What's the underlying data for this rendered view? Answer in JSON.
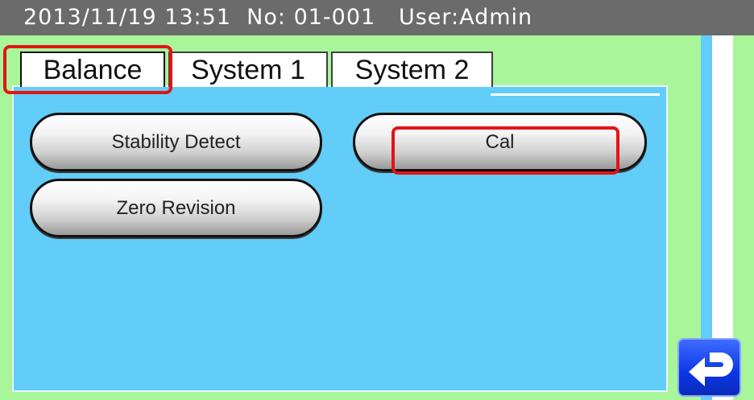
{
  "status": {
    "text": "2013/11/19 13:51  No: 01-001   User:Admin"
  },
  "tabs": [
    {
      "label": "Balance",
      "active": true
    },
    {
      "label": "System 1",
      "active": false
    },
    {
      "label": "System 2",
      "active": false
    }
  ],
  "buttons": {
    "stability_detect": "Stability Detect",
    "cal": "Cal",
    "zero_revision": "Zero Revision"
  },
  "icons": {
    "back": "return-arrow-icon"
  },
  "colors": {
    "panel": "#62cdf8",
    "background": "#a8f59a",
    "statusbar": "#6b6b6b",
    "highlight": "#e31414",
    "back_button": "#0b36e6"
  }
}
